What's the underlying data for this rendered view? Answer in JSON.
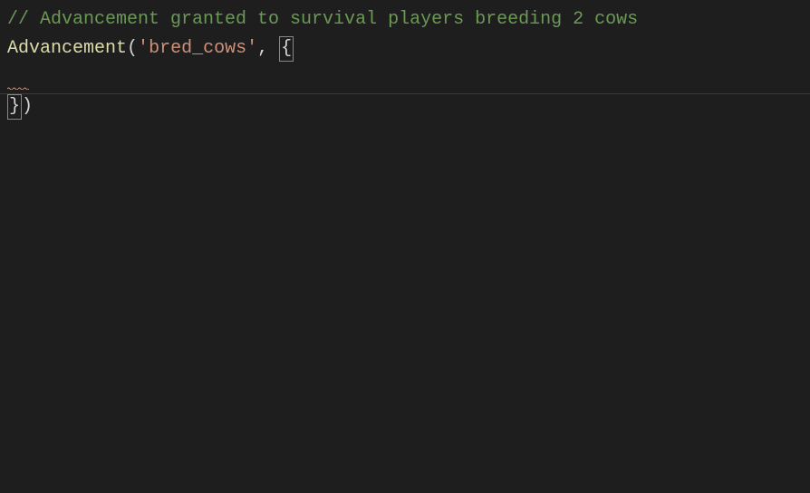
{
  "code": {
    "comment": "// Advancement granted to survival players breeding 2 cows",
    "func_name": "Advancement",
    "open_paren": "(",
    "string_quote1": "'",
    "string_value": "bred_cows",
    "string_quote2": "'",
    "comma_space": ", ",
    "open_brace": "{",
    "close_brace": "}",
    "close_paren": ")"
  }
}
